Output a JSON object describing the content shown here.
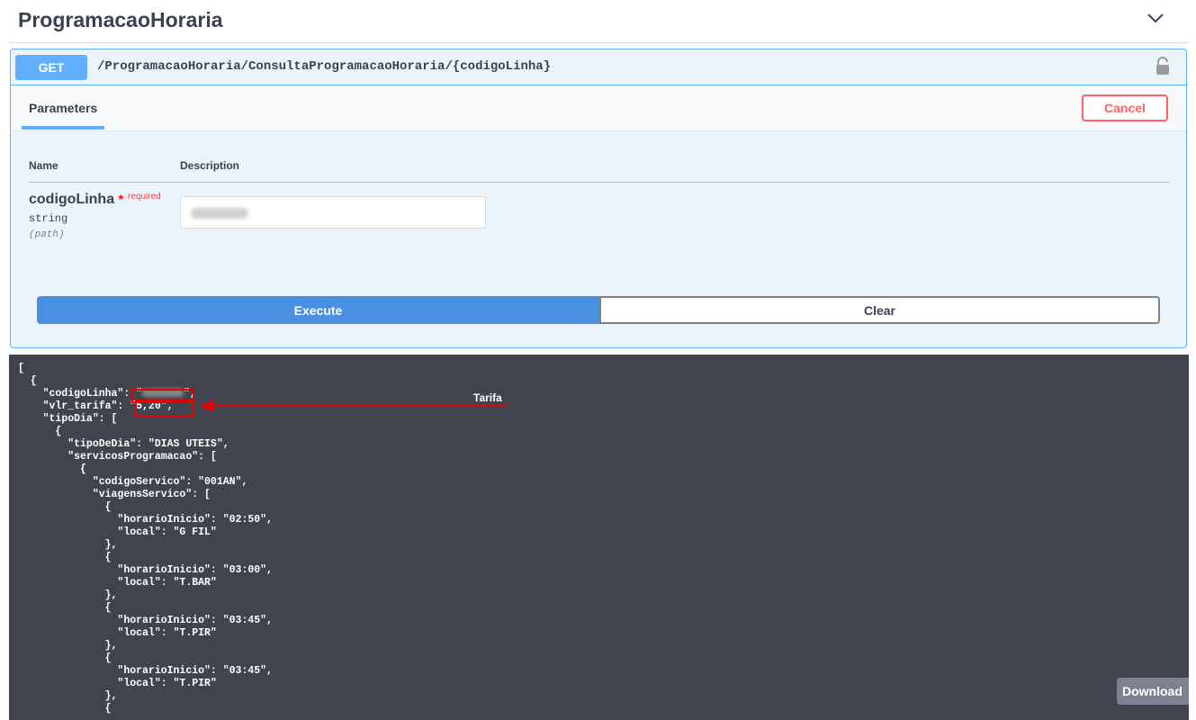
{
  "section": {
    "title": "ProgramacaoHoraria"
  },
  "operation": {
    "method": "GET",
    "path": "/ProgramacaoHoraria/ConsultaProgramacaoHoraria/{codigoLinha}"
  },
  "tabs": {
    "parameters": "Parameters"
  },
  "buttons": {
    "cancel": "Cancel",
    "execute": "Execute",
    "clear": "Clear",
    "download": "Download"
  },
  "columns": {
    "name": "Name",
    "description": "Description"
  },
  "parameter": {
    "name": "codigoLinha",
    "required_star": "*",
    "required_label": "required",
    "type": "string",
    "in": "(path)"
  },
  "response": {
    "annotation": "Tarifa",
    "lines_top": [
      "[",
      "  {",
      "    \"codigoLinha\": \"",
      "    \"vlr_tarifa\": \"5,20\",",
      "    \"tipoDia\": ["
    ],
    "lines_rest": "      {\n        \"tipoDeDia\": \"DIAS UTEIS\",\n        \"servicosProgramacao\": [\n          {\n            \"codigoServico\": \"001AN\",\n            \"viagensServico\": [\n              {\n                \"horarioInicio\": \"02:50\",\n                \"local\": \"G FIL\"\n              },\n              {\n                \"horarioInicio\": \"03:00\",\n                \"local\": \"T.BAR\"\n              },\n              {\n                \"horarioInicio\": \"03:45\",\n                \"local\": \"T.PIR\"\n              },\n              {\n                \"horarioInicio\": \"03:45\",\n                \"local\": \"T.PIR\"\n              },\n              {"
  },
  "colors": {
    "get_accent": "#61affe",
    "execute_blue": "#4990e2",
    "cancel_red": "#ff6060",
    "response_bg": "#41444e",
    "annotation_red": "#e30000"
  }
}
